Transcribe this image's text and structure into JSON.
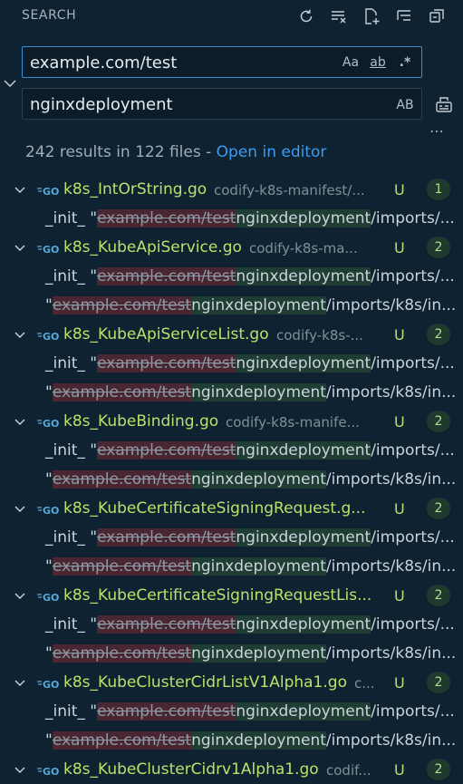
{
  "header": {
    "title": "SEARCH",
    "icons": [
      "refresh-icon",
      "clear-results-icon",
      "new-search-editor-icon",
      "view-as-tree-icon",
      "collapse-all-icon"
    ]
  },
  "search": {
    "value": "example.com/test",
    "opt_case": "Aa",
    "opt_word": "ab",
    "opt_regex": ".*"
  },
  "replace": {
    "value": "nginxdeployment",
    "opt_preserve": "AB"
  },
  "summary": {
    "text": "242 results in 122 files - ",
    "link": "Open in editor"
  },
  "colors": {
    "accent": "#3b9cf0",
    "file_green": "#b8e36b",
    "removed_bg": "#4a2632",
    "added_bg": "#1f3d33"
  },
  "files": [
    {
      "name": "k8s_IntOrString.go",
      "path": "codify-k8s-manifest/...",
      "status": "U",
      "count": "1",
      "matches": [
        {
          "pre": "_init_ \"",
          "removed": "example.com/test",
          "added": "nginxdeployment",
          "rest": "/imports/..."
        }
      ]
    },
    {
      "name": "k8s_KubeApiService.go",
      "path": "codify-k8s-ma...",
      "status": "U",
      "count": "2",
      "matches": [
        {
          "pre": "_init_ \"",
          "removed": "example.com/test",
          "added": "nginxdeployment",
          "rest": "/imports/..."
        },
        {
          "pre": "\"",
          "removed": "example.com/test",
          "added": "nginxdeployment",
          "rest": "/imports/k8s/in..."
        }
      ]
    },
    {
      "name": "k8s_KubeApiServiceList.go",
      "path": "codify-k8s-...",
      "status": "U",
      "count": "2",
      "matches": [
        {
          "pre": "_init_ \"",
          "removed": "example.com/test",
          "added": "nginxdeployment",
          "rest": "/imports/..."
        },
        {
          "pre": "\"",
          "removed": "example.com/test",
          "added": "nginxdeployment",
          "rest": "/imports/k8s/in..."
        }
      ]
    },
    {
      "name": "k8s_KubeBinding.go",
      "path": "codify-k8s-manife...",
      "status": "U",
      "count": "2",
      "matches": [
        {
          "pre": "_init_ \"",
          "removed": "example.com/test",
          "added": "nginxdeployment",
          "rest": "/imports/..."
        },
        {
          "pre": "\"",
          "removed": "example.com/test",
          "added": "nginxdeployment",
          "rest": "/imports/k8s/in..."
        }
      ]
    },
    {
      "name": "k8s_KubeCertificateSigningRequest.g...",
      "path": "",
      "status": "U",
      "count": "2",
      "matches": [
        {
          "pre": "_init_ \"",
          "removed": "example.com/test",
          "added": "nginxdeployment",
          "rest": "/imports/..."
        },
        {
          "pre": "\"",
          "removed": "example.com/test",
          "added": "nginxdeployment",
          "rest": "/imports/k8s/in..."
        }
      ]
    },
    {
      "name": "k8s_KubeCertificateSigningRequestLis...",
      "path": "",
      "status": "U",
      "count": "2",
      "matches": [
        {
          "pre": "_init_ \"",
          "removed": "example.com/test",
          "added": "nginxdeployment",
          "rest": "/imports/..."
        },
        {
          "pre": "\"",
          "removed": "example.com/test",
          "added": "nginxdeployment",
          "rest": "/imports/k8s/in..."
        }
      ]
    },
    {
      "name": "k8s_KubeClusterCidrListV1Alpha1.go",
      "path": "c...",
      "status": "U",
      "count": "2",
      "matches": [
        {
          "pre": "_init_ \"",
          "removed": "example.com/test",
          "added": "nginxdeployment",
          "rest": "/imports/..."
        },
        {
          "pre": "\"",
          "removed": "example.com/test",
          "added": "nginxdeployment",
          "rest": "/imports/k8s/in..."
        }
      ]
    },
    {
      "name": "k8s_KubeClusterCidrv1Alpha1.go",
      "path": "codif...",
      "status": "U",
      "count": "2",
      "matches": []
    }
  ]
}
